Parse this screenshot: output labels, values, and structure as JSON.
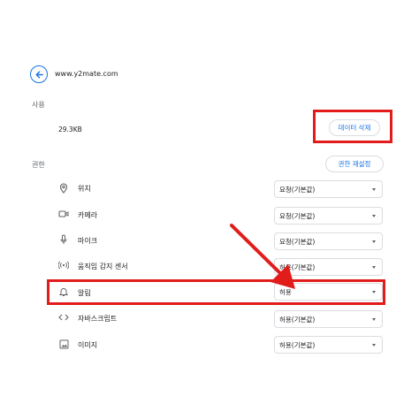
{
  "header": {
    "url": "www.y2mate.com",
    "back_icon": "arrow-left-icon"
  },
  "usage": {
    "label": "사용",
    "value": "29.3KB",
    "delete_button": "데이터 삭제"
  },
  "permissions": {
    "label": "권한",
    "reset_button": "권한 재설정",
    "rows": [
      {
        "icon": "location-pin-icon",
        "label": "위치",
        "value": "요청(기본값)"
      },
      {
        "icon": "camera-icon",
        "label": "카메라",
        "value": "요청(기본값)"
      },
      {
        "icon": "microphone-icon",
        "label": "마이크",
        "value": "요청(기본값)"
      },
      {
        "icon": "motion-sensor-icon",
        "label": "움직임 감지 센서",
        "value": "허용(기본값)"
      },
      {
        "icon": "bell-icon",
        "label": "알림",
        "value": "허용"
      },
      {
        "icon": "code-icon",
        "label": "자바스크립트",
        "value": "허용(기본값)"
      },
      {
        "icon": "image-icon",
        "label": "이미지",
        "value": "허용(기본값)"
      }
    ]
  },
  "colors": {
    "accent": "#1a73e8",
    "highlight": "#e21b1b"
  }
}
